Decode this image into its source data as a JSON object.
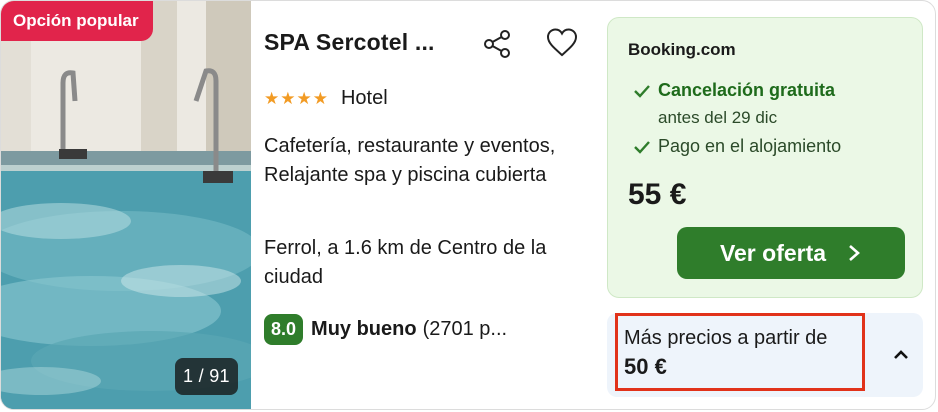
{
  "image": {
    "badge": "Opción popular",
    "counter": "1 / 91"
  },
  "hotel": {
    "name": "SPA Sercotel ...",
    "stars": "★★★★",
    "star_count": 4,
    "type": "Hotel",
    "amenities": "Cafetería, restaurante y eventos, Relajante spa y piscina cubierta",
    "location": "Ferrol, a 1.6 km de Centro de la ciudad",
    "score": "8.0",
    "score_label": "Muy bueno",
    "review_count": "(2701 p..."
  },
  "offer": {
    "provider": "Booking.com",
    "perk1": "Cancelación gratuita",
    "perk1_sub": "antes del 29 dic",
    "perk2": "Pago en el alojamiento",
    "price": "55 €",
    "cta": "Ver oferta"
  },
  "more_prices": {
    "label": "Más precios a partir de",
    "price": "50 €"
  },
  "icons": {
    "share": "share-icon",
    "favorite": "heart-icon",
    "check": "check-icon",
    "chevron_right": "chevron-right-icon",
    "chevron_up": "chevron-up-icon"
  },
  "colors": {
    "badge": "#e1244b",
    "accent_green": "#2f7d2b",
    "offer_bg": "#ebf8e6",
    "stars": "#f29b24",
    "highlight_border": "#e1321a"
  }
}
